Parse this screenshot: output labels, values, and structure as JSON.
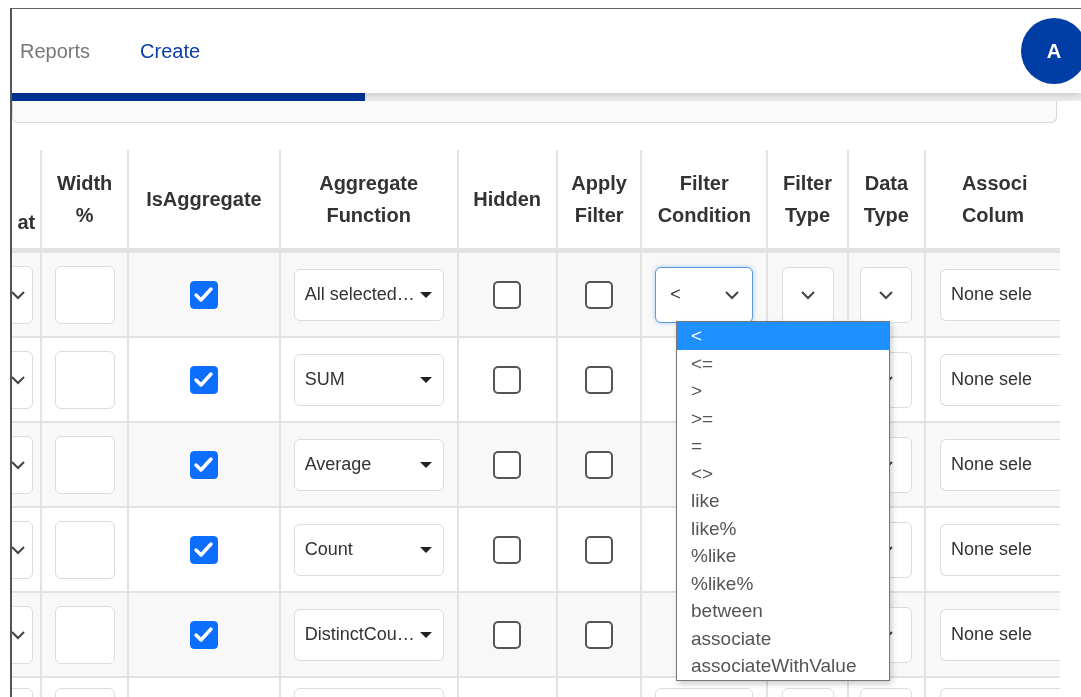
{
  "tabs": [
    {
      "label": "Reports",
      "selected": false
    },
    {
      "label": "Create",
      "selected": true
    }
  ],
  "avatar": {
    "initial": "A"
  },
  "progress": {
    "level": 0.33
  },
  "table": {
    "columns": [
      {
        "lines": [
          "at"
        ]
      },
      {
        "lines": [
          "Width",
          "%"
        ]
      },
      {
        "lines": [
          "IsAggregate"
        ]
      },
      {
        "lines": [
          "Aggregate",
          "Function"
        ]
      },
      {
        "lines": [
          "Hidden"
        ]
      },
      {
        "lines": [
          "Apply",
          "Filter"
        ]
      },
      {
        "lines": [
          "Filter",
          "Condition"
        ]
      },
      {
        "lines": [
          "Filter",
          "Type"
        ]
      },
      {
        "lines": [
          "Data",
          "Type"
        ]
      },
      {
        "lines": [
          "Associ",
          "Colum"
        ]
      }
    ],
    "rows": [
      {
        "is_aggregate": true,
        "aggregate_function": "All selected…",
        "hidden": false,
        "apply_filter": false,
        "filter_condition": "<",
        "associated_column": "None sele"
      },
      {
        "is_aggregate": true,
        "aggregate_function": "SUM",
        "hidden": false,
        "apply_filter": false,
        "associated_column": "None sele"
      },
      {
        "is_aggregate": true,
        "aggregate_function": "Average",
        "hidden": false,
        "apply_filter": false,
        "associated_column": "None sele"
      },
      {
        "is_aggregate": true,
        "aggregate_function": "Count",
        "hidden": false,
        "apply_filter": false,
        "associated_column": "None sele"
      },
      {
        "is_aggregate": true,
        "aggregate_function": "DistinctCou…",
        "hidden": false,
        "apply_filter": false,
        "associated_column": "None sele"
      }
    ]
  },
  "filter_dropdown": {
    "options": [
      {
        "label": "<",
        "selected": true
      },
      {
        "label": "<=",
        "selected": false
      },
      {
        "label": ">",
        "selected": false
      },
      {
        "label": ">=",
        "selected": false
      },
      {
        "label": "=",
        "selected": false
      },
      {
        "label": "<>",
        "selected": false
      },
      {
        "label": "like",
        "selected": false
      },
      {
        "label": "like%",
        "selected": false
      },
      {
        "label": "%like",
        "selected": false
      },
      {
        "label": "%like%",
        "selected": false
      },
      {
        "label": "between",
        "selected": false
      },
      {
        "label": "associate",
        "selected": false
      },
      {
        "label": "associateWithValue",
        "selected": false
      }
    ]
  }
}
